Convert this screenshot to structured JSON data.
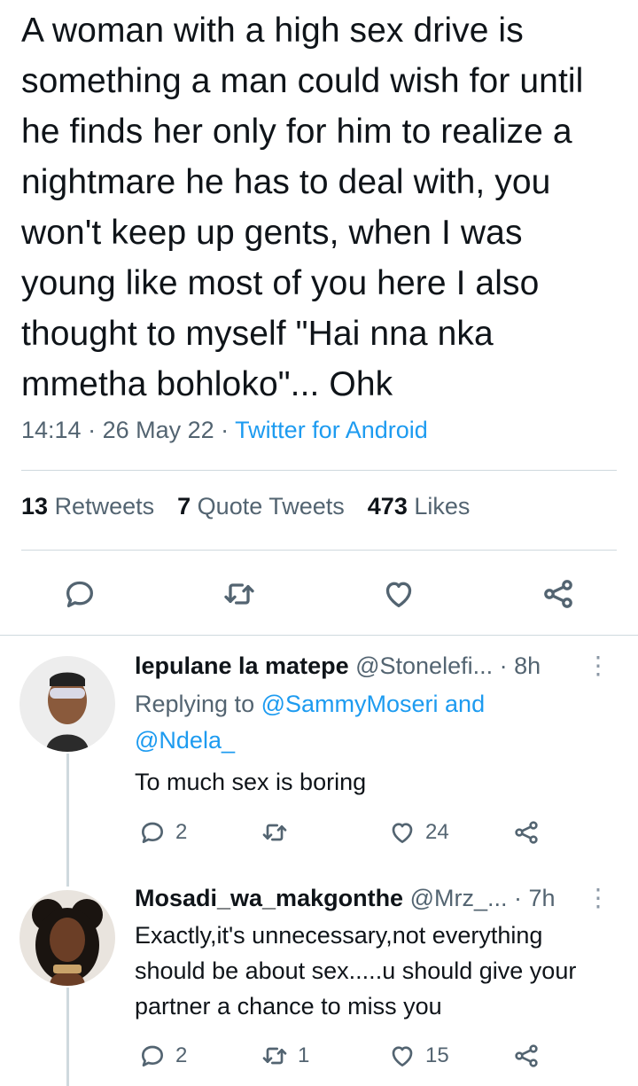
{
  "tweet": {
    "text": "A woman with a high sex drive is something a man could wish for until he finds her only for him to realize a nightmare he has to deal with, you won't keep up gents, when I was young like most of you here I also thought to myself \"Hai nna nka mmetha bohloko\"... Ohk",
    "time": "14:14",
    "sep1": " · ",
    "date": "26 May 22",
    "sep2": " · ",
    "source": "Twitter for Android"
  },
  "stats": {
    "retweets_count": "13",
    "retweets_label": "Retweets",
    "quotes_count": "7",
    "quotes_label": "Quote Tweets",
    "likes_count": "473",
    "likes_label": "Likes"
  },
  "actions": {
    "icons": [
      "reply-icon",
      "retweet-icon",
      "like-icon",
      "share-icon"
    ]
  },
  "replies": [
    {
      "name": "lepulane la matepe",
      "handle": "@Stonelefi...",
      "dot": " · ",
      "time": "8h",
      "replying_prefix": "Replying to ",
      "mention1": "@SammyMoseri",
      "and": " and",
      "mention2": "@Ndela_",
      "text": "To much sex is boring",
      "reply_count": "2",
      "retweet_count": "",
      "like_count": "24",
      "avatar_colors": [
        "#f2f2f2",
        "#2b2b2b",
        "#8a5a3c"
      ]
    },
    {
      "name": "Mosadi_wa_makgonthe",
      "handle": "@Mrz_...",
      "dot": " · ",
      "time": "7h",
      "text": "Exactly,it's unnecessary,not everything should be about sex.....u should give your partner a chance to miss you",
      "reply_count": "2",
      "retweet_count": "1",
      "like_count": "15",
      "avatar_colors": [
        "#1a1410",
        "#6b3e26",
        "#c9a36a"
      ]
    }
  ]
}
